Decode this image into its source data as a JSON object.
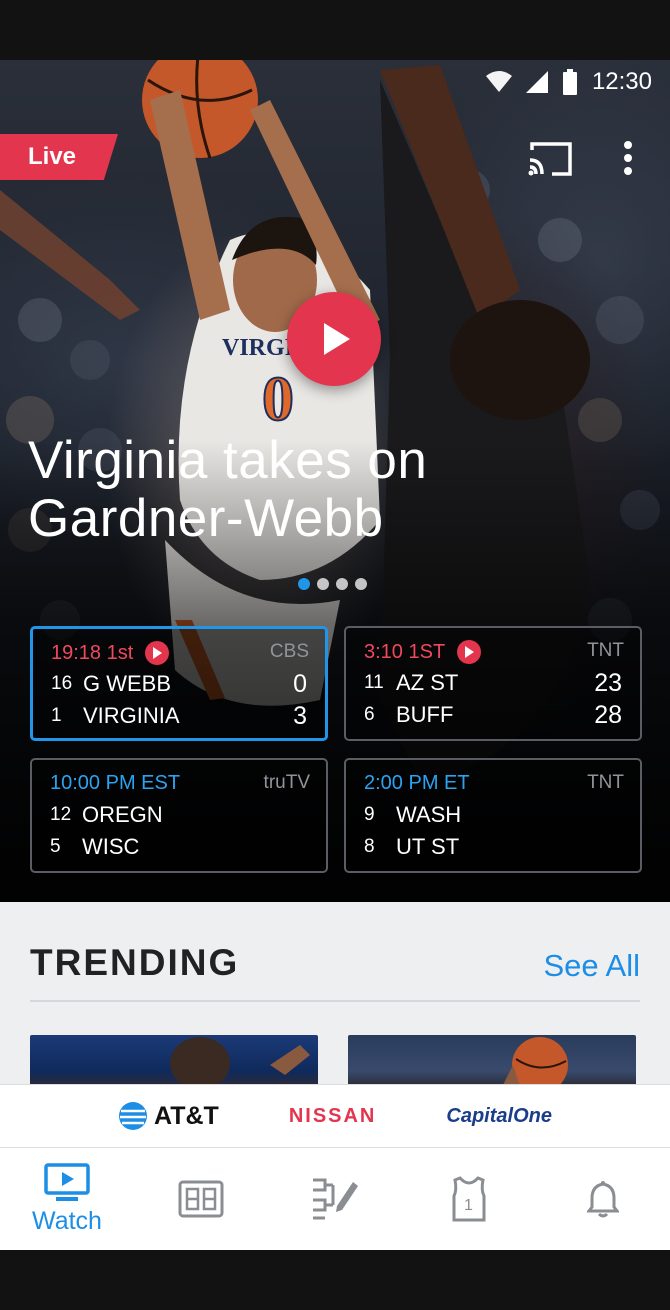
{
  "status_bar": {
    "time": "12:30",
    "icons": [
      "wifi-icon",
      "signal-icon",
      "battery-icon"
    ]
  },
  "hero": {
    "live_label": "Live",
    "headline_line1": "Virginia takes on",
    "headline_line2": "Gardner-Webb",
    "carousel_dots": 4,
    "carousel_active_index": 0,
    "icons": [
      "cast-icon",
      "more-vert-icon",
      "play-icon"
    ]
  },
  "games": [
    {
      "status": "19:18 1st",
      "is_live": true,
      "network": "CBS",
      "team1": {
        "seed": "16",
        "name": "G WEBB",
        "score": "0"
      },
      "team2": {
        "seed": "1",
        "name": "VIRGINIA",
        "score": "3"
      }
    },
    {
      "status": "3:10 1ST",
      "is_live": true,
      "network": "TNT",
      "team1": {
        "seed": "11",
        "name": "AZ ST",
        "score": "23"
      },
      "team2": {
        "seed": "6",
        "name": "BUFF",
        "score": "28"
      }
    },
    {
      "status": "10:00 PM EST",
      "is_live": false,
      "network": "truTV",
      "team1": {
        "seed": "12",
        "name": "OREGN",
        "score": ""
      },
      "team2": {
        "seed": "5",
        "name": "WISC",
        "score": ""
      }
    },
    {
      "status": "2:00 PM ET",
      "is_live": false,
      "network": "TNT",
      "team1": {
        "seed": "9",
        "name": "WASH",
        "score": ""
      },
      "team2": {
        "seed": "8",
        "name": "UT ST",
        "score": ""
      }
    }
  ],
  "trending": {
    "title": "TRENDING",
    "see_all": "See All"
  },
  "sponsors": {
    "att": "AT&T",
    "nissan": "NISSAN",
    "capital_one": "CapitalOne"
  },
  "nav": {
    "watch_label": "Watch",
    "items": [
      "watch-icon",
      "scores-icon",
      "bracket-icon",
      "jersey-icon",
      "bell-icon"
    ]
  },
  "colors": {
    "accent_red": "#e3354e",
    "accent_blue": "#2196e8",
    "live_text": "#f0485f",
    "upcoming_text": "#2aa3f2"
  }
}
